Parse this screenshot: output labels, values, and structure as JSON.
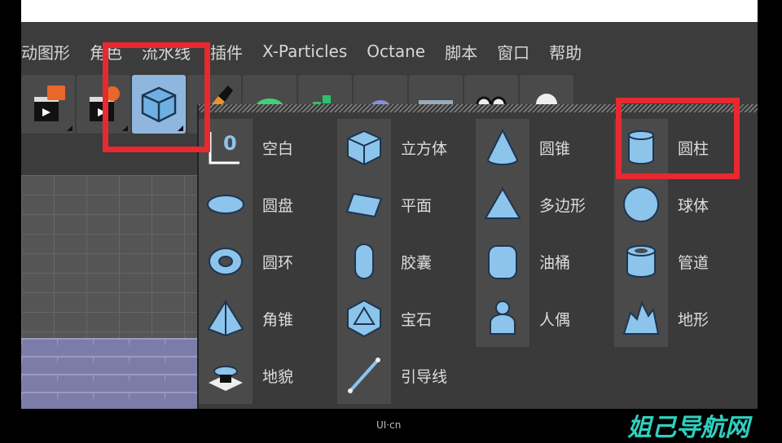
{
  "menu": [
    "动图形",
    "角色",
    "流水线",
    "插件",
    "X-Particles",
    "Octane",
    "脚本",
    "窗口",
    "帮助"
  ],
  "toolbar": [
    "clapper-orange-icon",
    "clapper-gear-icon",
    "cube-icon",
    "pen-icon",
    "spline-icon",
    "cloner-icon",
    "deformer-icon",
    "floor-icon",
    "eyes-icon",
    "light-icon"
  ],
  "objects": [
    {
      "label": "空白",
      "icon": "null-icon"
    },
    {
      "label": "立方体",
      "icon": "cube-icon"
    },
    {
      "label": "圆锥",
      "icon": "cone-icon"
    },
    {
      "label": "圆柱",
      "icon": "cylinder-icon"
    },
    {
      "label": "圆盘",
      "icon": "disc-icon"
    },
    {
      "label": "平面",
      "icon": "plane-icon"
    },
    {
      "label": "多边形",
      "icon": "polygon-icon"
    },
    {
      "label": "球体",
      "icon": "sphere-icon"
    },
    {
      "label": "圆环",
      "icon": "torus-icon"
    },
    {
      "label": "胶囊",
      "icon": "capsule-icon"
    },
    {
      "label": "油桶",
      "icon": "oiltank-icon"
    },
    {
      "label": "管道",
      "icon": "tube-icon"
    },
    {
      "label": "角锥",
      "icon": "pyramid-icon"
    },
    {
      "label": "宝石",
      "icon": "platonic-icon"
    },
    {
      "label": "人偶",
      "icon": "figure-icon"
    },
    {
      "label": "地形",
      "icon": "landscape-icon"
    },
    {
      "label": "地貌",
      "icon": "relief-icon"
    },
    {
      "label": "引导线",
      "icon": "guide-icon"
    }
  ],
  "null_glyph": "0",
  "footer": {
    "logo": "UI·cn",
    "watermark": "姐己导航网"
  },
  "colors": {
    "highlight": "#e8292f",
    "icon": "#8cc4ec"
  }
}
